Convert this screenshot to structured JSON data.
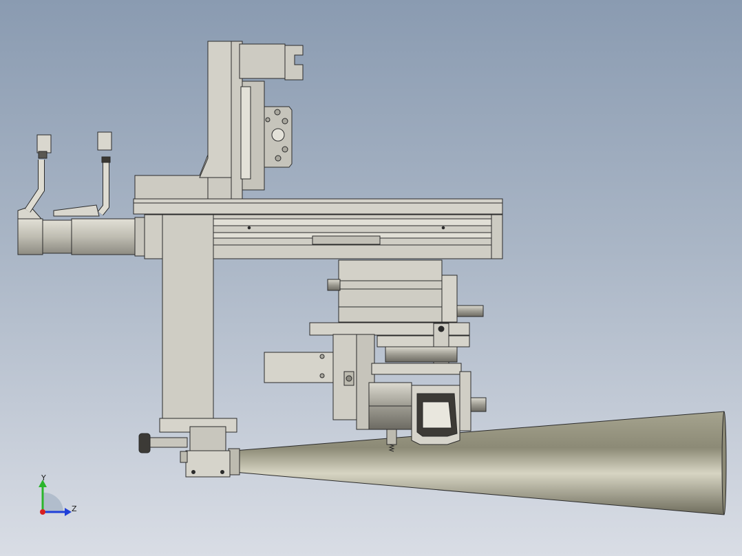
{
  "viewport": {
    "background_top": "#8a9bb1",
    "background_bottom": "#d9dde5",
    "part_fill": "#cdcbc2",
    "part_stroke": "#2a2a2a"
  },
  "triad": {
    "y_label": "Y",
    "z_label": "Z",
    "y_color": "#2bb52b",
    "z_color": "#1f3fd8",
    "x_color": "#d81f1f"
  },
  "model": {
    "view_name": "front-view",
    "components": [
      "vertical-column",
      "top-bracket",
      "horizontal-linear-module",
      "servo-motor",
      "cable-connectors",
      "slide-carriage",
      "gripper-assembly",
      "air-cylinder",
      "clamp-hand",
      "lower-adjust-knob",
      "conical-nozzle"
    ]
  }
}
